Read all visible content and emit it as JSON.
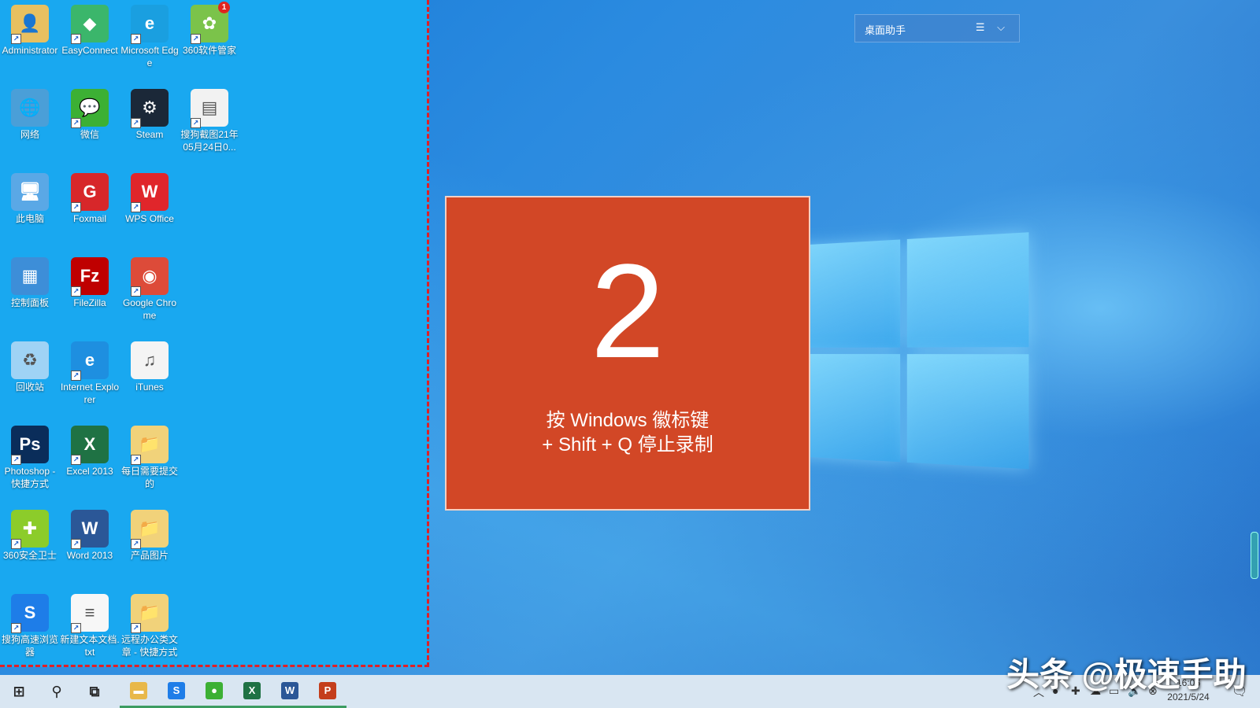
{
  "desktop_icons": [
    {
      "label": "Administrator",
      "icon": "user-folder-icon",
      "color": "#e8c060"
    },
    {
      "label": "EasyConnect",
      "icon": "easyconnect-icon",
      "color": "#3bb66b"
    },
    {
      "label": "Microsoft Edge",
      "icon": "edge-icon",
      "color": "#1a9fe0"
    },
    {
      "label": "360软件管家",
      "icon": "360-software-icon",
      "color": "#7bc34a",
      "badge": "1"
    },
    {
      "label": "网络",
      "icon": "network-icon",
      "color": "#4a9fd8"
    },
    {
      "label": "微信",
      "icon": "wechat-icon",
      "color": "#3cb034"
    },
    {
      "label": "Steam",
      "icon": "steam-icon",
      "color": "#1b2838"
    },
    {
      "label": "搜狗截图21年05月24日0...",
      "icon": "screenshot-file-icon",
      "color": "#f2f2f2"
    },
    {
      "label": "此电脑",
      "icon": "this-pc-icon",
      "color": "#5aa8e6"
    },
    {
      "label": "Foxmail",
      "icon": "foxmail-icon",
      "color": "#d7272a"
    },
    {
      "label": "WPS Office",
      "icon": "wps-icon",
      "color": "#e0262b"
    },
    {
      "label": "控制面板",
      "icon": "control-panel-icon",
      "color": "#3d8ed8"
    },
    {
      "label": "FileZilla",
      "icon": "filezilla-icon",
      "color": "#bf0000"
    },
    {
      "label": "Google Chrome",
      "icon": "chrome-icon",
      "color": "#dd4b39"
    },
    {
      "label": "回收站",
      "icon": "recycle-bin-icon",
      "color": "#9fd3f5"
    },
    {
      "label": "Internet Explorer",
      "icon": "ie-icon",
      "color": "#1e8fe0"
    },
    {
      "label": "iTunes",
      "icon": "itunes-icon",
      "color": "#f4f4f4"
    },
    {
      "label": "Photoshop - 快捷方式",
      "icon": "photoshop-icon",
      "color": "#0a2d5a"
    },
    {
      "label": "Excel 2013",
      "icon": "excel-icon",
      "color": "#1f7244"
    },
    {
      "label": "每日需要提交的",
      "icon": "folder-icon",
      "color": "#f1d27a"
    },
    {
      "label": "360安全卫士",
      "icon": "360-safe-icon",
      "color": "#8ccc2a"
    },
    {
      "label": "Word 2013",
      "icon": "word-icon",
      "color": "#2b5797"
    },
    {
      "label": "产品图片",
      "icon": "folder-icon",
      "color": "#f1d27a"
    },
    {
      "label": "搜狗高速浏览器",
      "icon": "sogou-browser-icon",
      "color": "#1e7de8"
    },
    {
      "label": "新建文本文档.txt",
      "icon": "text-file-icon",
      "color": "#f7f7f7"
    },
    {
      "label": "远程办公类文章 - 快捷方式",
      "icon": "folder-icon",
      "color": "#f1d27a"
    }
  ],
  "countdown": {
    "number": "2",
    "line1": "按 Windows 徽标键",
    "line2": "+ Shift + Q 停止录制",
    "bg_color": "#d24726"
  },
  "widget": {
    "title": "桌面助手",
    "controls": "☰ ⌵"
  },
  "taskbar": {
    "items": [
      {
        "name": "start-button",
        "glyph": "⊞"
      },
      {
        "name": "search-button",
        "glyph": "⚲"
      },
      {
        "name": "task-view-button",
        "glyph": "⧉"
      },
      {
        "name": "file-explorer",
        "glyph": "▬",
        "color": "#e8b84a"
      },
      {
        "name": "sogou-browser",
        "glyph": "S",
        "color": "#1e7de8"
      },
      {
        "name": "wechat",
        "glyph": "●",
        "color": "#3cb034"
      },
      {
        "name": "excel",
        "glyph": "X",
        "color": "#1f7244"
      },
      {
        "name": "word",
        "glyph": "W",
        "color": "#2b5797"
      },
      {
        "name": "powerpoint",
        "glyph": "P",
        "color": "#c43e1c"
      }
    ],
    "tray_icons": [
      "chevron-up-icon",
      "wechat-tray-icon",
      "360-tray-icon",
      "cloud-off-icon",
      "network-tray-icon",
      "volume-icon",
      "close-circle-icon"
    ],
    "time": "16:06",
    "date": "2021/5/24",
    "notification_icon": "notification-icon"
  },
  "watermark": "头条 @极速手助"
}
